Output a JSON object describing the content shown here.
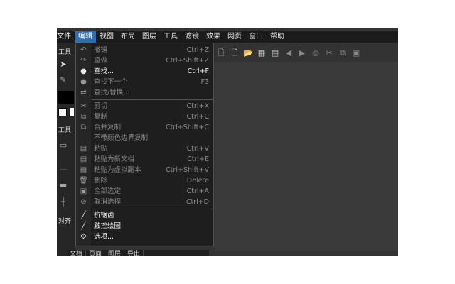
{
  "menubar": [
    "文件",
    "编辑",
    "视图",
    "布局",
    "图层",
    "工具",
    "滤镜",
    "效果",
    "网页",
    "窗口",
    "帮助"
  ],
  "active_menu": "编辑",
  "left_panel": {
    "label_top": "工具",
    "label_mid": "工具",
    "label_align": "对齐"
  },
  "edit_menu": {
    "items": [
      {
        "label": "撤销",
        "shortcut": "Ctrl+Z",
        "enabled": false,
        "icon": "undo-icon"
      },
      {
        "label": "重做",
        "shortcut": "Ctrl+Shift+Z",
        "enabled": false,
        "icon": "redo-icon"
      },
      {
        "label": "查找...",
        "shortcut": "Ctrl+F",
        "enabled": true,
        "icon": "find-icon"
      },
      {
        "label": "查找下一个",
        "shortcut": "F3",
        "enabled": false,
        "icon": "find-next-icon"
      },
      {
        "label": "查找/替换...",
        "shortcut": "",
        "enabled": false,
        "icon": "replace-icon"
      },
      {
        "separator": true
      },
      {
        "label": "剪切",
        "shortcut": "Ctrl+X",
        "enabled": false,
        "icon": "cut-icon"
      },
      {
        "label": "复制",
        "shortcut": "Ctrl+C",
        "enabled": false,
        "icon": "copy-icon"
      },
      {
        "label": "合并复制",
        "shortcut": "Ctrl+Shift+C",
        "enabled": false,
        "icon": "copy-merged-icon"
      },
      {
        "label": "不带颜色边界复制",
        "shortcut": "",
        "enabled": false,
        "icon": ""
      },
      {
        "label": "粘贴",
        "shortcut": "Ctrl+V",
        "enabled": false,
        "icon": "paste-icon"
      },
      {
        "label": "粘贴为新文档",
        "shortcut": "Ctrl+E",
        "enabled": false,
        "icon": "paste-new-icon"
      },
      {
        "label": "粘贴为虚拟副本",
        "shortcut": "Ctrl+Shift+V",
        "enabled": false,
        "icon": "paste-virtual-icon"
      },
      {
        "label": "删除",
        "shortcut": "Delete",
        "enabled": false,
        "icon": "delete-icon"
      },
      {
        "label": "全部选定",
        "shortcut": "Ctrl+A",
        "enabled": false,
        "icon": "select-all-icon"
      },
      {
        "label": "取消选择",
        "shortcut": "Ctrl+D",
        "enabled": false,
        "icon": "deselect-icon"
      },
      {
        "separator": true
      },
      {
        "label": "抗锯齿",
        "shortcut": "",
        "enabled": true,
        "icon": "antialias-icon"
      },
      {
        "label": "触控绘图",
        "shortcut": "",
        "enabled": true,
        "icon": "touch-draw-icon"
      },
      {
        "label": "选项...",
        "shortcut": "",
        "enabled": true,
        "icon": "options-icon"
      }
    ]
  },
  "bottom_tabs": [
    "文档",
    "页面",
    "图层",
    "导出"
  ],
  "colors": {
    "app_bg": "#333333",
    "menu_bg": "#1e1e1e",
    "active_menu_bg": "#2f6fb0",
    "enabled_text": "#f2f2f2",
    "disabled_text": "#8a8a8a"
  }
}
